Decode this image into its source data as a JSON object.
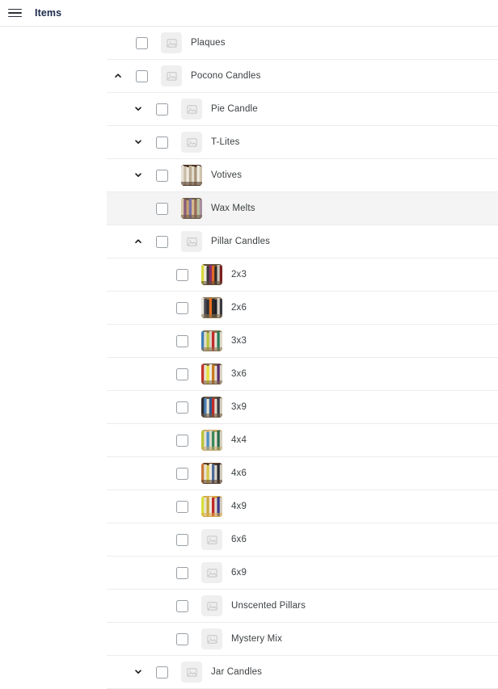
{
  "appbar": {
    "menu_icon": "hamburger-menu-icon",
    "title": "Items"
  },
  "tree": {
    "rows": [
      {
        "label": "Plaques",
        "indent": 0,
        "toggle": "none",
        "thumb": "placeholder",
        "highlight": false
      },
      {
        "label": "Pocono Candles",
        "indent": 0,
        "toggle": "up",
        "thumb": "placeholder",
        "highlight": false
      },
      {
        "label": "Pie Candle",
        "indent": 1,
        "toggle": "down",
        "thumb": "placeholder",
        "highlight": false
      },
      {
        "label": "T-Lites",
        "indent": 1,
        "toggle": "down",
        "thumb": "placeholder",
        "highlight": false
      },
      {
        "label": "Votives",
        "indent": 1,
        "toggle": "down",
        "thumb": "photo-votives",
        "highlight": false
      },
      {
        "label": "Wax Melts",
        "indent": 1,
        "toggle": "none",
        "thumb": "photo-waxmelts",
        "highlight": true
      },
      {
        "label": "Pillar Candles",
        "indent": 1,
        "toggle": "up",
        "thumb": "placeholder",
        "highlight": false
      },
      {
        "label": "2x3",
        "indent": 2,
        "toggle": "none",
        "thumb": "photo-2x3",
        "highlight": false
      },
      {
        "label": "2x6",
        "indent": 2,
        "toggle": "none",
        "thumb": "photo-2x6",
        "highlight": false
      },
      {
        "label": "3x3",
        "indent": 2,
        "toggle": "none",
        "thumb": "photo-3x3",
        "highlight": false
      },
      {
        "label": "3x6",
        "indent": 2,
        "toggle": "none",
        "thumb": "photo-3x6",
        "highlight": false
      },
      {
        "label": "3x9",
        "indent": 2,
        "toggle": "none",
        "thumb": "photo-3x9",
        "highlight": false
      },
      {
        "label": "4x4",
        "indent": 2,
        "toggle": "none",
        "thumb": "photo-4x4",
        "highlight": false
      },
      {
        "label": "4x6",
        "indent": 2,
        "toggle": "none",
        "thumb": "photo-4x6",
        "highlight": false
      },
      {
        "label": "4x9",
        "indent": 2,
        "toggle": "none",
        "thumb": "photo-4x9",
        "highlight": false
      },
      {
        "label": "6x6",
        "indent": 2,
        "toggle": "none",
        "thumb": "placeholder",
        "highlight": false
      },
      {
        "label": "6x9",
        "indent": 2,
        "toggle": "none",
        "thumb": "placeholder",
        "highlight": false
      },
      {
        "label": "Unscented Pillars",
        "indent": 2,
        "toggle": "none",
        "thumb": "placeholder",
        "highlight": false
      },
      {
        "label": "Mystery Mix",
        "indent": 2,
        "toggle": "none",
        "thumb": "placeholder",
        "highlight": false
      },
      {
        "label": "Jar Candles",
        "indent": 1,
        "toggle": "down",
        "thumb": "placeholder",
        "highlight": false
      }
    ]
  },
  "colors": {
    "appbar_title": "#1b2a4a",
    "row_label": "#3c4043",
    "divider": "#ececec",
    "row_hover": "#f4f4f4",
    "checkbox_border": "#9aa0a6",
    "placeholder_bg": "#efefef"
  }
}
